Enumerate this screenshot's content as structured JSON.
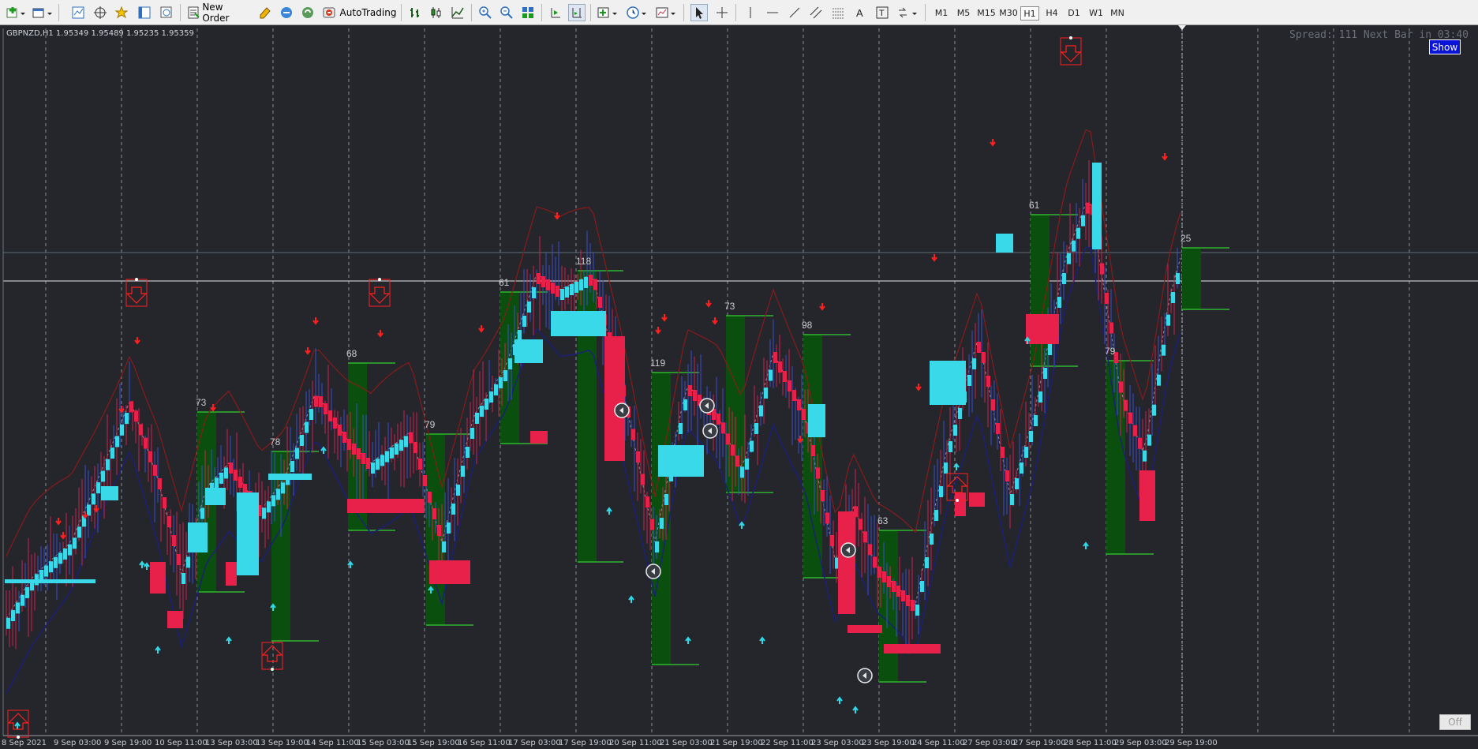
{
  "toolbar": {
    "new_order_label": "New Order",
    "autotrading_label": "AutoTrading",
    "timeframes": [
      "M1",
      "M5",
      "M15",
      "M30",
      "H1",
      "H4",
      "D1",
      "W1",
      "MN"
    ],
    "active_timeframe": "H1"
  },
  "chart": {
    "symbol_info": "GBPNZD,H1  1.95349 1.95489 1.95235 1.95359",
    "spread_text": "Spread: 111 Next Bar in 03:40",
    "show_button": "Show",
    "off_button": "Off",
    "x_labels": [
      "8 Sep 2021",
      "9 Sep 03:00",
      "9 Sep 19:00",
      "10 Sep 11:00",
      "13 Sep 03:00",
      "13 Sep 19:00",
      "14 Sep 11:00",
      "15 Sep 03:00",
      "15 Sep 19:00",
      "16 Sep 11:00",
      "17 Sep 03:00",
      "17 Sep 19:00",
      "20 Sep 11:00",
      "21 Sep 03:00",
      "21 Sep 19:00",
      "22 Sep 11:00",
      "23 Sep 03:00",
      "23 Sep 19:00",
      "24 Sep 11:00",
      "27 Sep 03:00",
      "27 Sep 19:00",
      "28 Sep 11:00",
      "29 Sep 03:00",
      "29 Sep 19:00"
    ],
    "box_labels": [
      "73",
      "78",
      "68",
      "79",
      "61",
      "118",
      "119",
      "73",
      "98",
      "63",
      "61",
      "79",
      "25"
    ],
    "colors": {
      "background": "#24262b",
      "bull": "#39d9ea",
      "bear": "#e8214a",
      "box_green": "#0b4f0e",
      "box_line": "#2fb52f",
      "upper_band": "#8a1a1a",
      "lower_band": "#1c1f7a",
      "arrow_down": "#ff1f1f",
      "arrow_up": "#2fd9e6"
    }
  }
}
